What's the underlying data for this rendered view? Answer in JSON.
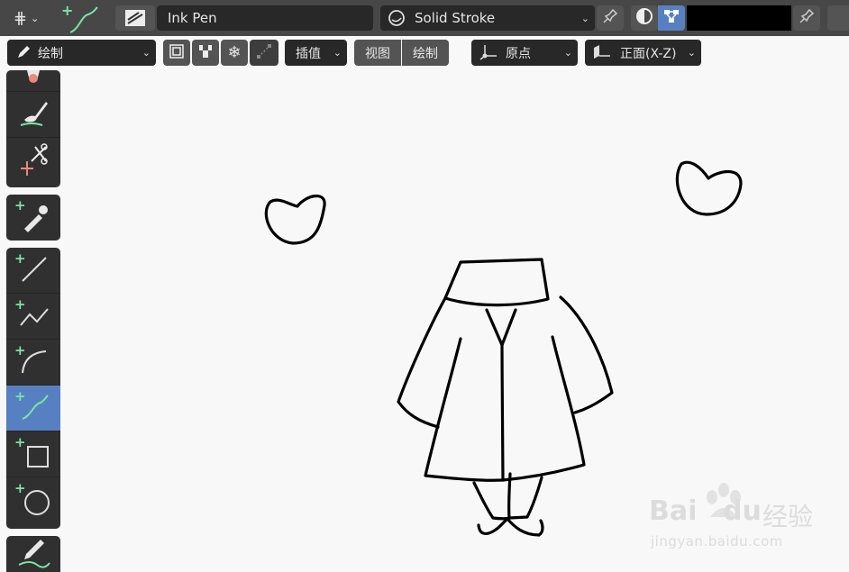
{
  "header": {
    "brush_name": "Ink Pen",
    "material_name": "Solid Stroke"
  },
  "toolbar": {
    "mode_label": "绘制",
    "interpolate_label": "插值",
    "view_label": "视图",
    "draw_label": "绘制",
    "origin_label": "原点",
    "plane_label": "正面(X-Z)"
  },
  "watermark": {
    "brand": "Bai",
    "brand2": "du",
    "cn": "经验",
    "url": "jingyan.baidu.com"
  },
  "colors": {
    "accent": "#5680c2",
    "tool_plus": "#7be4a4",
    "panel": "#474747"
  }
}
